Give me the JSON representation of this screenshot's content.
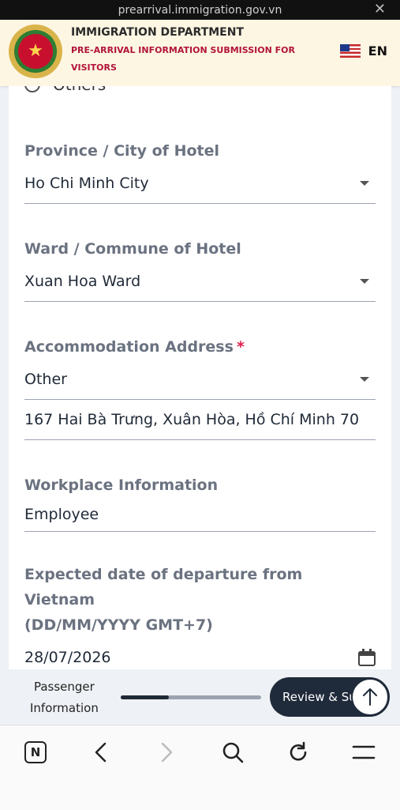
{
  "browser": {
    "url": "prearrival.immigration.gov.vn",
    "close_glyph": "✕"
  },
  "header": {
    "department": "IMMIGRATION DEPARTMENT",
    "subtitle": "PRE-ARRIVAL INFORMATION SUBMISSION FOR VISITORS",
    "language": "EN"
  },
  "form": {
    "radio_option": "Others",
    "province": {
      "label": "Province / City of Hotel",
      "value": "Ho Chi Minh City"
    },
    "ward": {
      "label": "Ward / Commune of Hotel",
      "value": "Xuan Hoa Ward"
    },
    "accommodation": {
      "label": "Accommodation Address",
      "required_mark": "*",
      "value": "Other",
      "address": "167 Hai Bà Trưng, Xuân Hòa, Hồ Chí Minh 70"
    },
    "workplace": {
      "label": "Workplace Information",
      "value": "Employee"
    },
    "departure": {
      "label_line1": "Expected date of departure from Vietnam",
      "label_line2": "(DD/MM/YYYY GMT+7)",
      "value": "28/07/2026"
    }
  },
  "progress": {
    "step_label_line1": "Passenger",
    "step_label_line2": "Information",
    "fraction": 0.34,
    "review_label": "Review & Submit"
  },
  "colors": {
    "accent": "#1f2a3a",
    "required": "#e11d48",
    "brand_red": "#b1143a"
  }
}
